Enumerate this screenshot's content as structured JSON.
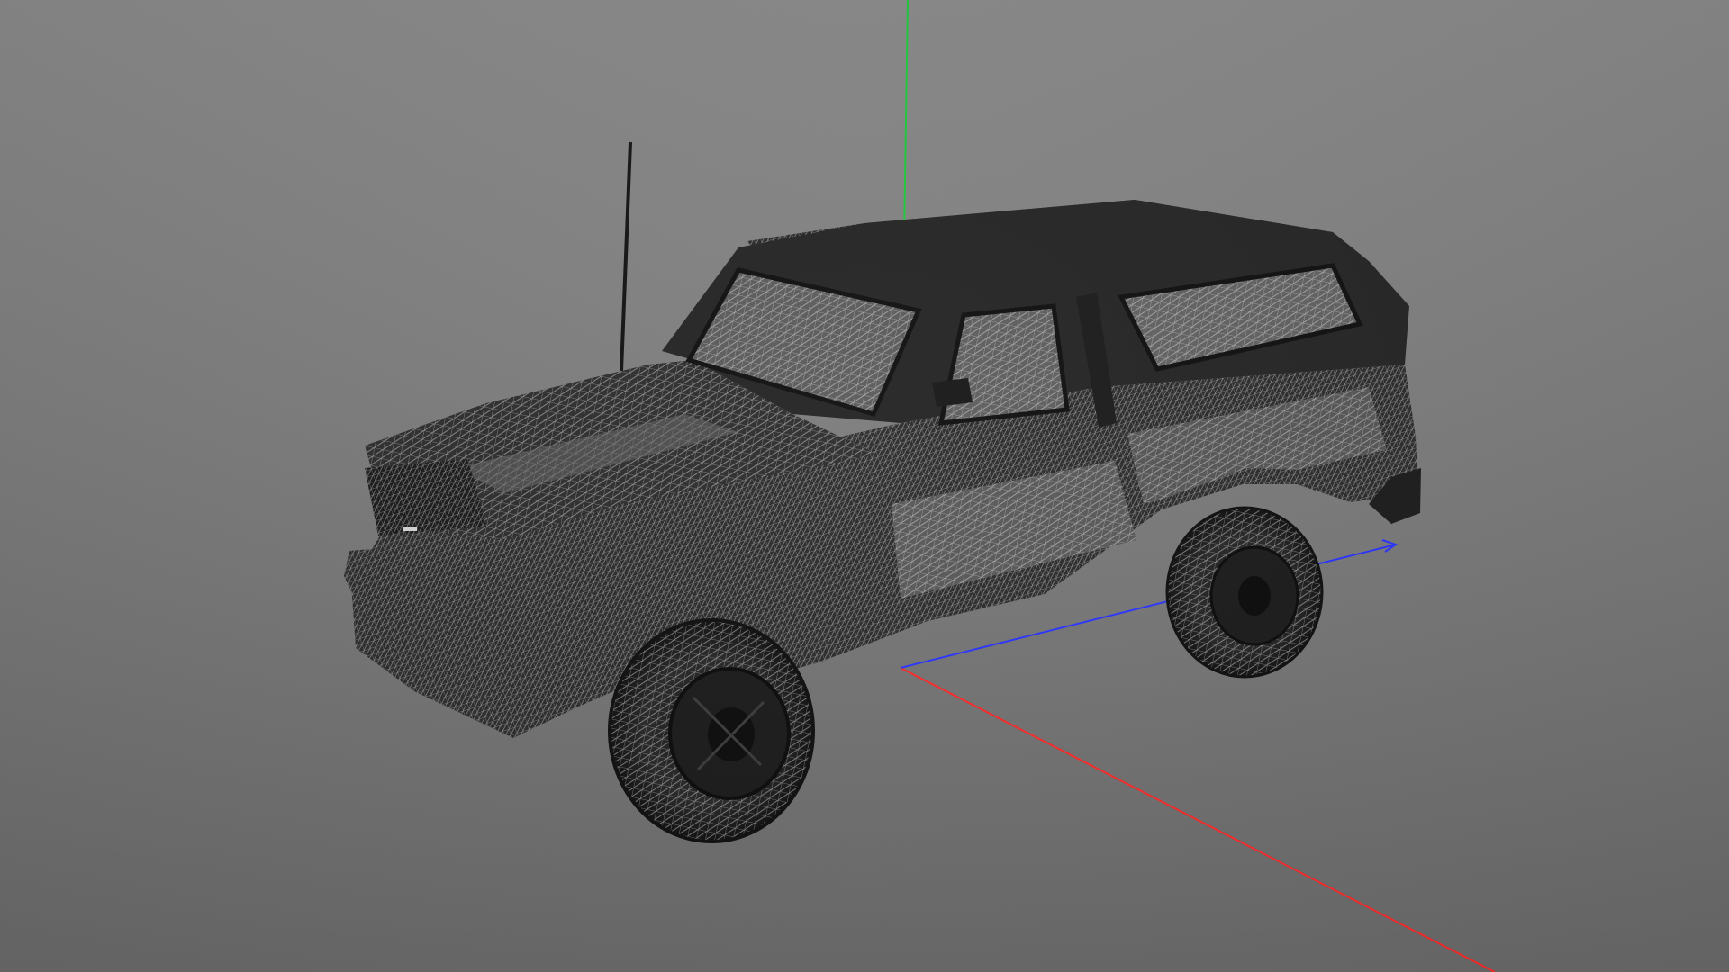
{
  "viewport": {
    "background_top": "#8a8a8a",
    "background_bottom": "#6b6b6b"
  },
  "model": {
    "name": "",
    "display_mode": "wireframe",
    "mesh_fill": "#2b2b2b",
    "wire_color": "#f2f2f2"
  },
  "axes": {
    "x_color": "#ff2a2a",
    "y_color": "#1ecb3a",
    "z_color": "#2a35ff"
  },
  "icons": {
    "gizmo": "axis-gizmo-icon"
  }
}
